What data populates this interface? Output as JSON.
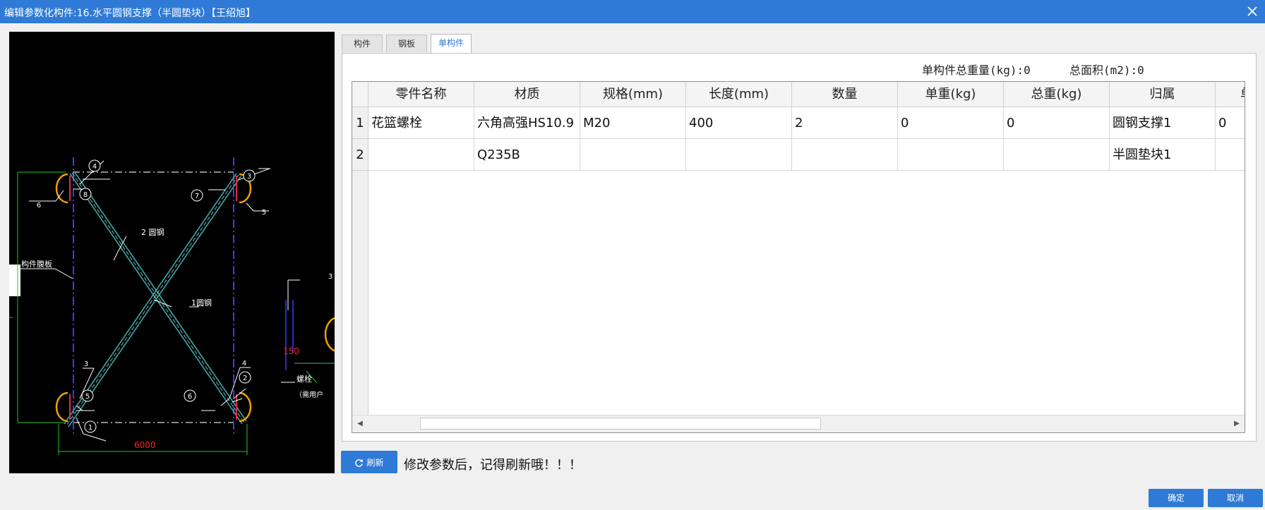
{
  "window": {
    "title": "编辑参数化构件:16.水平圆钢支撑（半圆垫块）【王绍旭】"
  },
  "drawing": {
    "labels": {
      "n4": "4",
      "n3_top": "3",
      "n8": "8",
      "n7": "7",
      "n5_tr": "5",
      "n6_tl": "6",
      "n3_side": "3",
      "n4_br": "4",
      "n5_bl": "5",
      "n6_br": "6",
      "n2_br": "2",
      "n1": "1",
      "round_steel_2": "2 圆钢",
      "round_steel_1": "1圆钢",
      "web_plate": "构件腹板",
      "dim_6000": "6000",
      "dim_150": "150",
      "bolt": "螺栓",
      "bolt_note": "（需用户",
      "side_3": "3"
    }
  },
  "tabs": [
    {
      "label": "构件",
      "active": false
    },
    {
      "label": "钢板",
      "active": false
    },
    {
      "label": "单构件",
      "active": true
    }
  ],
  "totals": {
    "weight": "单构件总重量(kg):0",
    "area": "总面积(m2):0"
  },
  "table": {
    "columns": [
      "零件名称",
      "材质",
      "规格(mm)",
      "长度(mm)",
      "数量",
      "单重(kg)",
      "总重(kg)",
      "归属",
      "单"
    ],
    "rows": [
      {
        "num": "1",
        "cells": [
          "花篮螺栓",
          "六角高强HS10.9",
          "M20",
          "400",
          "2",
          "0",
          "0",
          "圆钢支撑1",
          "0"
        ]
      },
      {
        "num": "2",
        "cells": [
          "",
          "Q235B",
          "",
          "",
          "",
          "",
          "",
          "半圆垫块1",
          ""
        ]
      }
    ]
  },
  "refresh": {
    "label": "刷新",
    "note": "修改参数后，记得刷新哦！！！"
  },
  "footer": {
    "ok": "确定",
    "cancel": "取消"
  },
  "colors": {
    "accent": "#2f7ad6",
    "cad_background": "#000000"
  }
}
